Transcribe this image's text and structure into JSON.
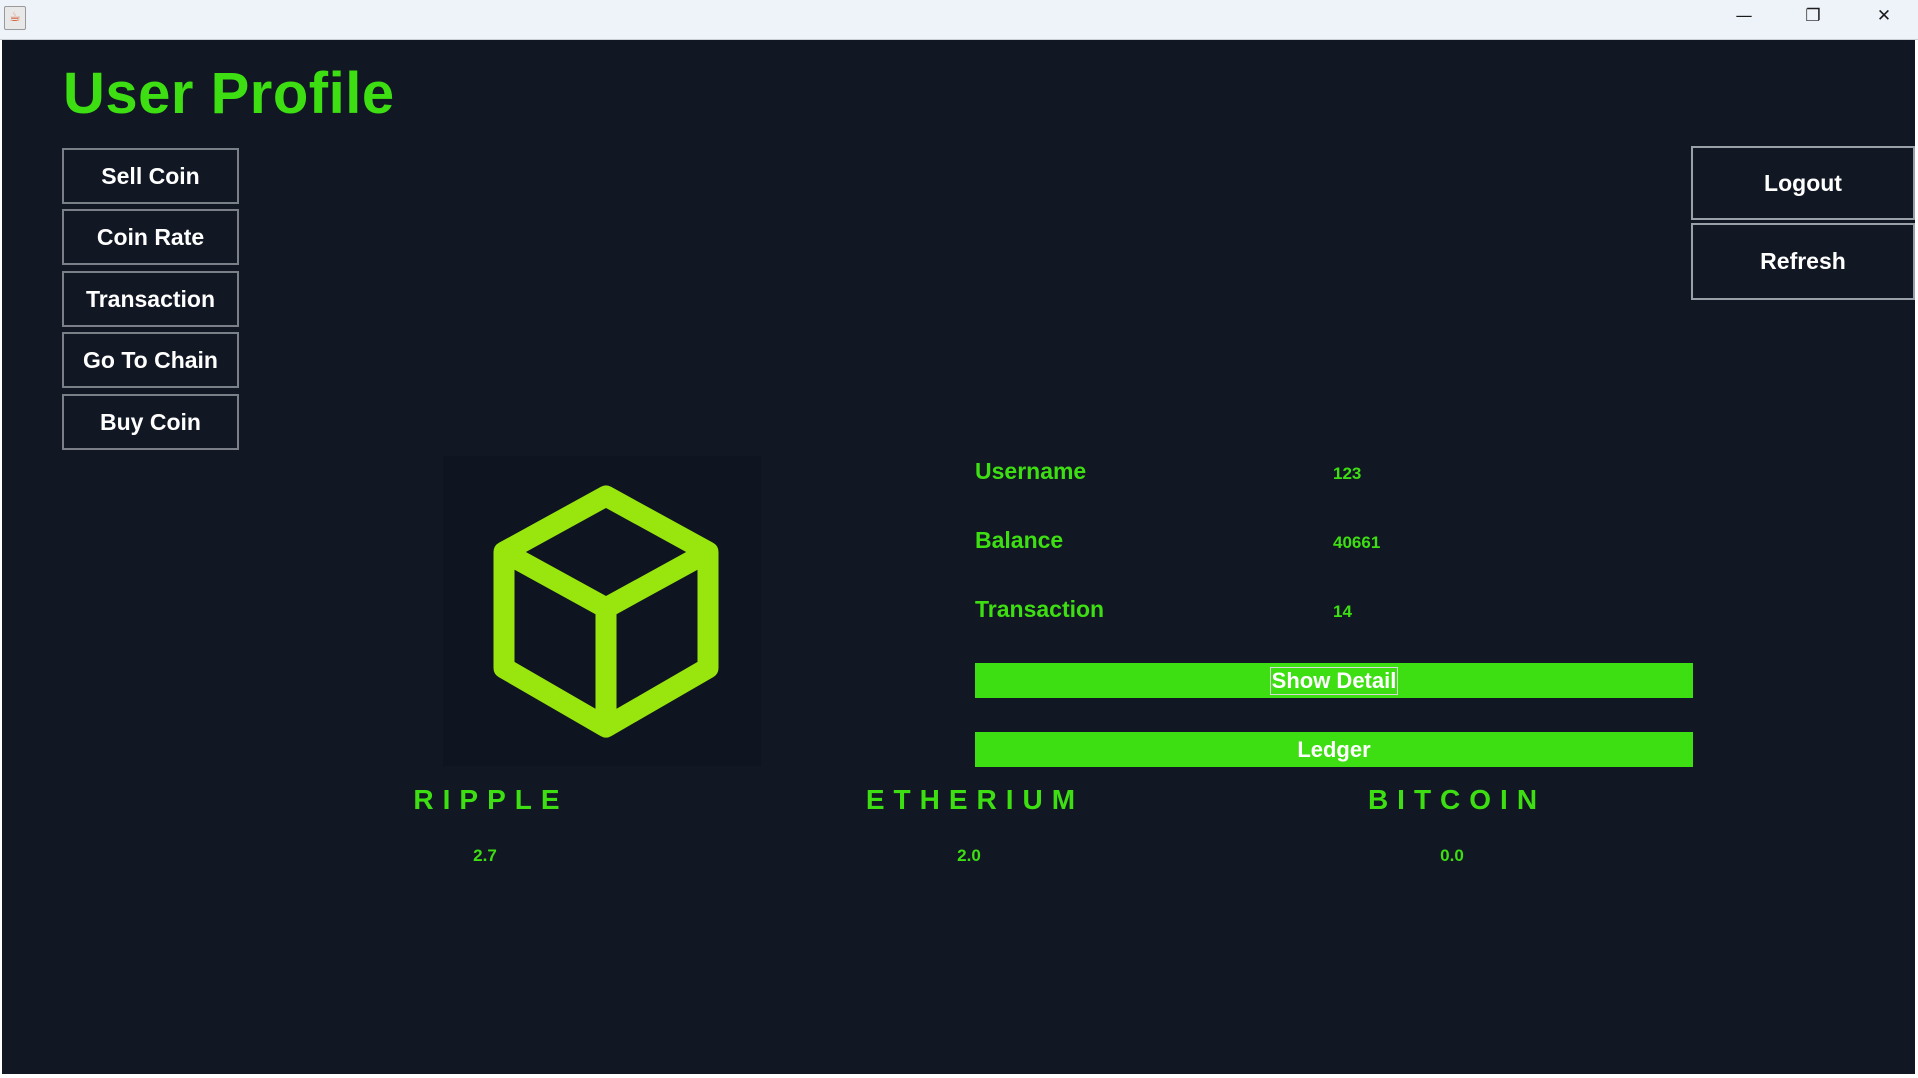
{
  "titlebar": {
    "icon": "java-cup-icon",
    "minimize_glyph": "—",
    "restore_glyph": "❐",
    "close_glyph": "✕"
  },
  "page": {
    "title": "User Profile"
  },
  "nav": {
    "items": [
      {
        "label": "Sell Coin"
      },
      {
        "label": "Coin Rate"
      },
      {
        "label": "Transaction"
      },
      {
        "label": "Go To Chain"
      },
      {
        "label": "Buy Coin"
      }
    ]
  },
  "actions": {
    "logout_label": "Logout",
    "refresh_label": "Refresh"
  },
  "logo": {
    "icon": "cube-icon",
    "color": "#99e60f"
  },
  "profile": {
    "username_label": "Username",
    "username_value": "123",
    "balance_label": "Balance",
    "balance_value": "40661",
    "transaction_label": "Transaction",
    "transaction_value": "14",
    "show_detail_label": "Show Detail",
    "ledger_label": "Ledger"
  },
  "coins": [
    {
      "name": "RIPPLE",
      "value": "2.7"
    },
    {
      "name": "ETHERIUM",
      "value": "2.0"
    },
    {
      "name": "BITCOIN",
      "value": "0.0"
    }
  ],
  "colors": {
    "accent": "#3dde12",
    "background": "#111723",
    "button_text": "#ffffff"
  }
}
